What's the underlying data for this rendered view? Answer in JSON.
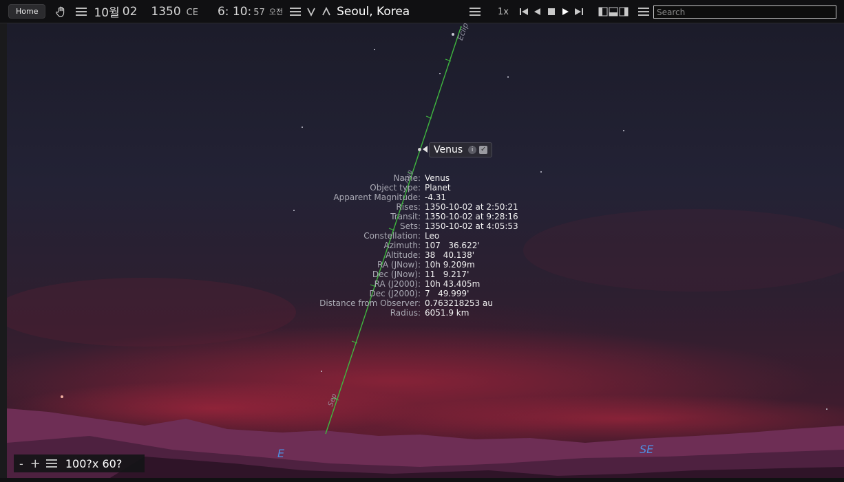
{
  "toolbar": {
    "home_label": "Home",
    "date_month": "10월",
    "date_day": "02",
    "year": "1350",
    "era": "CE",
    "time_hm": "6: 10:",
    "time_s": "57",
    "ampm": "오전",
    "location": "Seoul, Korea",
    "speed": "1x",
    "search_placeholder": "Search"
  },
  "sky": {
    "ecliptic_label": "Ecliptic",
    "sep_label": "Sep",
    "aug_label": "Aug",
    "compass": {
      "east": "E",
      "southeast": "SE"
    }
  },
  "selected_object": {
    "label": "Venus",
    "info": [
      {
        "key": "Name:",
        "value": "Venus"
      },
      {
        "key": "Object type:",
        "value": "Planet"
      },
      {
        "key": "Apparent Magnitude:",
        "value": "-4.31"
      },
      {
        "key": "Rises:",
        "value": "1350-10-02 at 2:50:21"
      },
      {
        "key": "Transit:",
        "value": "1350-10-02 at 9:28:16"
      },
      {
        "key": "Sets:",
        "value": "1350-10-02 at 4:05:53"
      },
      {
        "key": "Constellation:",
        "value": "Leo"
      },
      {
        "key": "Azimuth:",
        "value": "107   36.622'"
      },
      {
        "key": "Altitude:",
        "value": "38   40.138'"
      },
      {
        "key": "RA (JNow):",
        "value": "10h 9.209m"
      },
      {
        "key": "Dec (JNow):",
        "value": "11   9.217'"
      },
      {
        "key": "RA (J2000):",
        "value": "10h 43.405m"
      },
      {
        "key": "Dec (J2000):",
        "value": "7   49.999'"
      },
      {
        "key": "Distance from Observer:",
        "value": "0.763218253 au"
      },
      {
        "key": "Radius:",
        "value": "6051.9 km"
      }
    ]
  },
  "fov": {
    "zoom_out": "-",
    "zoom_in": "+",
    "value": "100?x 60?"
  },
  "colors": {
    "ecliptic": "#3fb83f",
    "compass": "#4f8ee0",
    "sky_glow": "#7a1f35"
  }
}
